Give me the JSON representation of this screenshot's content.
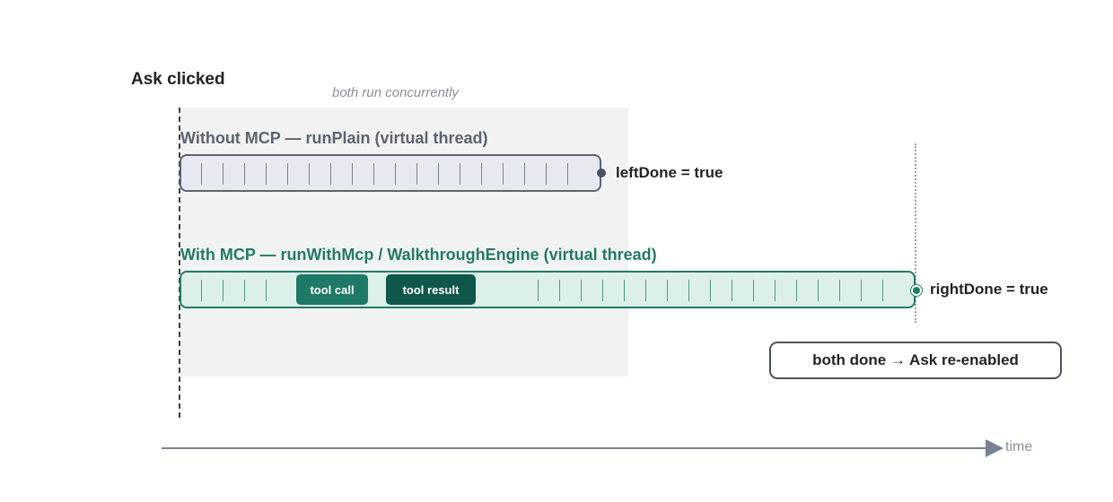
{
  "title": "Ask clicked",
  "concurrent_label": "both run concurrently",
  "lanes": {
    "plain": {
      "label": "Without MCP — runPlain (virtual thread)",
      "done_label": "leftDone = true"
    },
    "mcp": {
      "label": "With MCP — runWithMcp / WalkthroughEngine (virtual thread)",
      "done_label": "rightDone = true",
      "tool_call_label": "tool call",
      "tool_result_label": "tool result"
    }
  },
  "completion_label": "both done → Ask re-enabled",
  "axis_label": "time",
  "colors": {
    "plain_lane": "#5a6472",
    "mcp_lane": "#237a66",
    "tool_call": "#1e7a66",
    "tool_result": "#0f574a"
  }
}
